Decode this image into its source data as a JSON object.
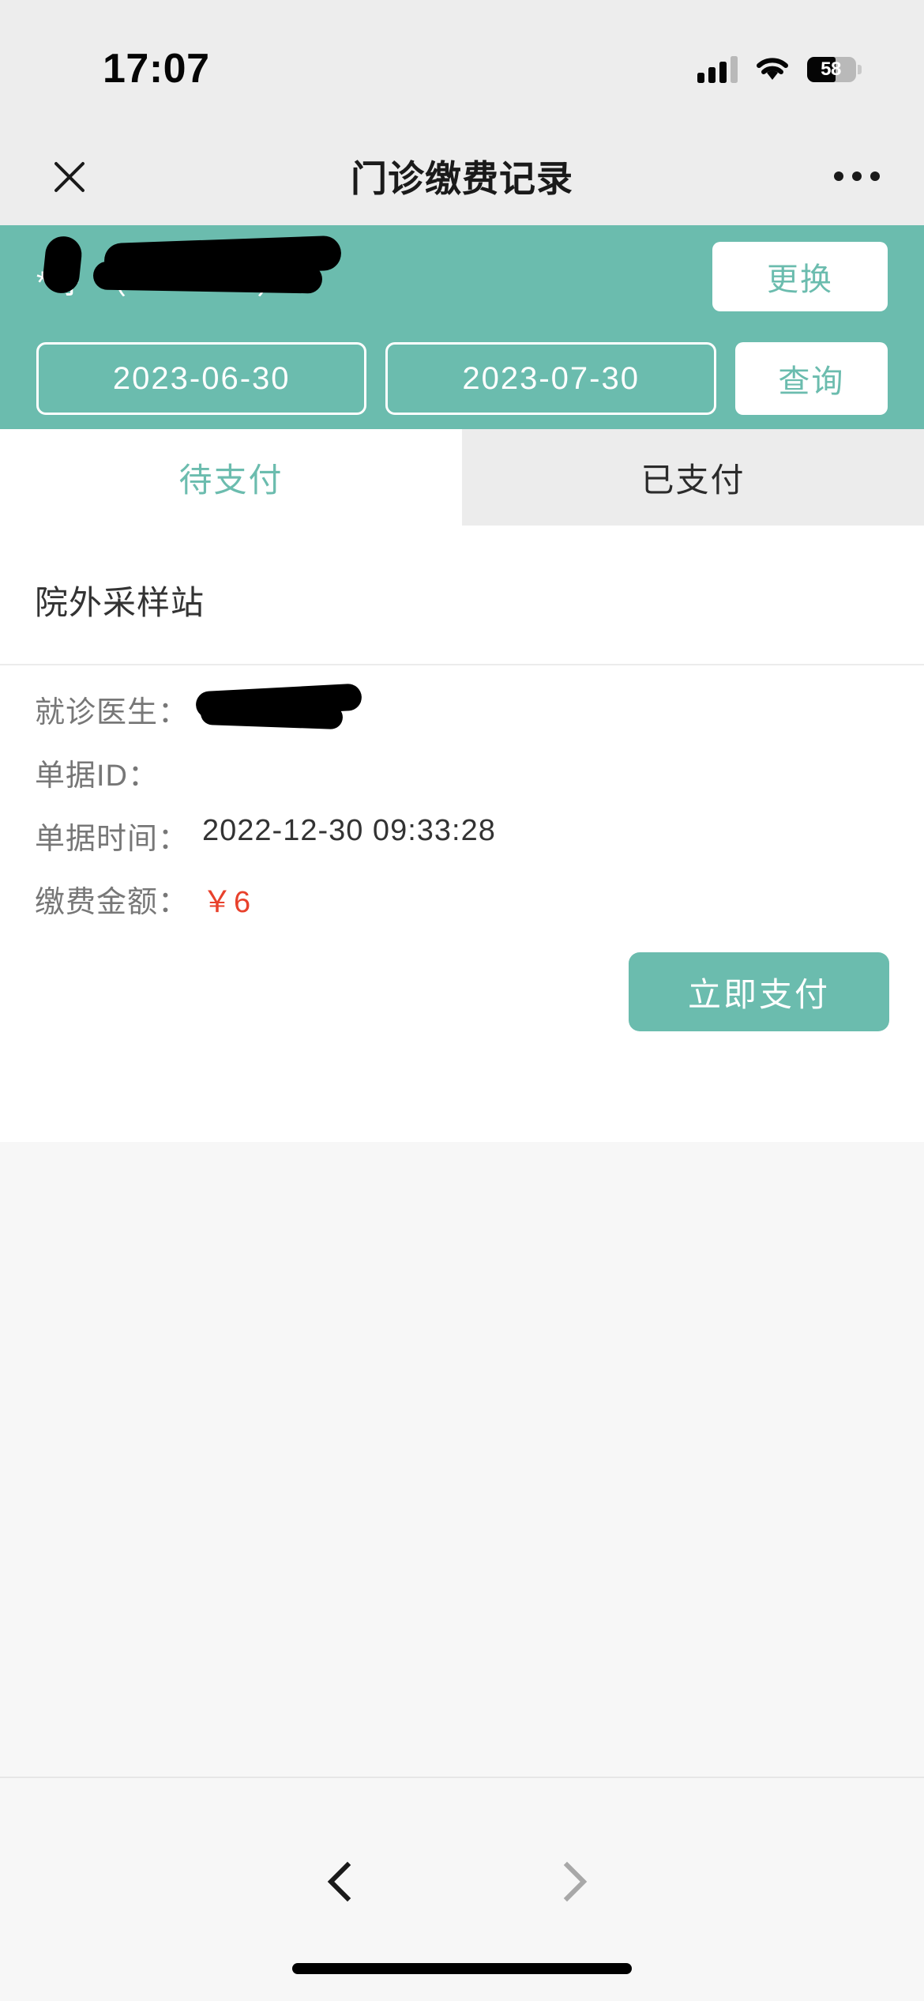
{
  "status_bar": {
    "time": "17:07",
    "battery_level": "58",
    "battery_percent": 58,
    "signal_icon": "cellular-signal-icon",
    "wifi_icon": "wifi-icon",
    "battery_icon": "battery-icon"
  },
  "nav_bar": {
    "close_icon": "close-icon",
    "title": "门诊缴费记录",
    "more_icon": "more-options-icon"
  },
  "header": {
    "patient_name": "**扌（　　　　）",
    "change_button": "更换",
    "start_date": "2023-06-30",
    "end_date": "2023-07-30",
    "query_button": "查询"
  },
  "tabs": [
    {
      "label": "待支付",
      "active": true
    },
    {
      "label": "已支付",
      "active": false
    }
  ],
  "record": {
    "title": "院外采样站",
    "fields": [
      {
        "label": "就诊医生：",
        "value": "",
        "redacted": true
      },
      {
        "label": "单据ID：",
        "value": "",
        "redacted": false
      },
      {
        "label": "单据时间：",
        "value": "2022-12-30 09:33:28",
        "redacted": false
      },
      {
        "label": "缴费金额：",
        "value": "￥6",
        "redacted": false,
        "money": true
      }
    ],
    "pay_button": "立即支付"
  },
  "bottom_bar": {
    "back_icon": "chevron-left-icon",
    "forward_icon": "chevron-right-icon",
    "home_indicator": "home-indicator"
  },
  "colors": {
    "accent_teal": "#6bbcae",
    "money_red": "#e8412c",
    "chrome_gray": "#ededed",
    "page_gray": "#f7f7f7"
  }
}
